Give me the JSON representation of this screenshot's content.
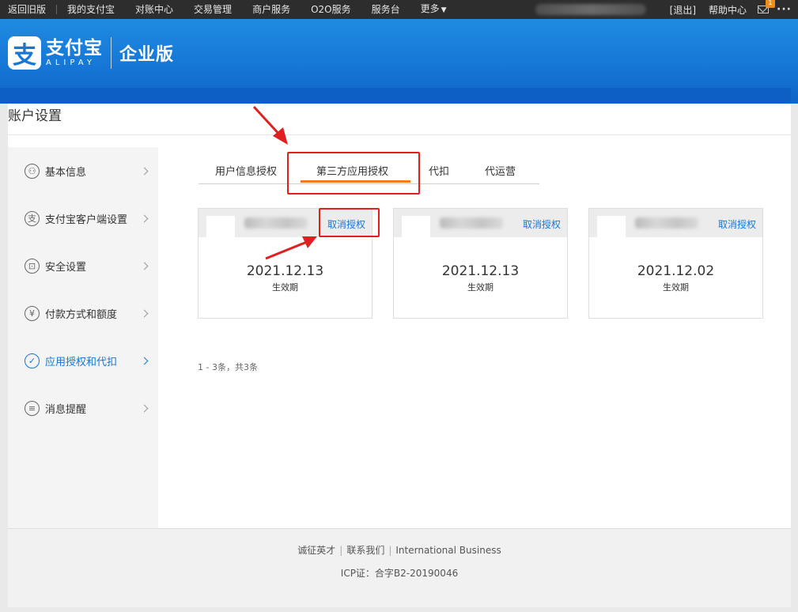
{
  "topnav": {
    "links": [
      "返回旧版",
      "我的支付宝",
      "对账中心",
      "交易管理",
      "商户服务",
      "O2O服务",
      "服务台",
      "更多"
    ],
    "logout": "[退出]",
    "help": "帮助中心",
    "mail_count": "1",
    "more_dots": "···"
  },
  "header": {
    "logo_glyph": "支",
    "brand_cn": "支付宝",
    "brand_en": "ALIPAY",
    "edition": "企业版"
  },
  "page": {
    "title": "账户设置"
  },
  "sidebar": {
    "items": [
      {
        "label": "基本信息",
        "icon": "user-icon",
        "glyph": "⚇"
      },
      {
        "label": "支付宝客户端设置",
        "icon": "alipay-icon",
        "glyph": "支"
      },
      {
        "label": "安全设置",
        "icon": "lock-icon",
        "glyph": "⊡"
      },
      {
        "label": "付款方式和额度",
        "icon": "yen-icon",
        "glyph": "¥"
      },
      {
        "label": "应用授权和代扣",
        "icon": "check-icon",
        "glyph": "✓"
      },
      {
        "label": "消息提醒",
        "icon": "message-icon",
        "glyph": "≡"
      }
    ]
  },
  "tabs": [
    {
      "label": "用户信息授权"
    },
    {
      "label": "第三方应用授权",
      "active": true
    },
    {
      "label": "代扣"
    },
    {
      "label": "代运营"
    }
  ],
  "cards": [
    {
      "revoke": "取消授权",
      "date": "2021.12.13",
      "date_label": "生效期"
    },
    {
      "revoke": "取消授权",
      "date": "2021.12.13",
      "date_label": "生效期"
    },
    {
      "revoke": "取消授权",
      "date": "2021.12.02",
      "date_label": "生效期"
    }
  ],
  "pagination": "1 - 3条，共3条",
  "footer": {
    "links": [
      "诚征英才",
      "联系我们",
      "International Business"
    ],
    "icp": "ICP证：合字B2-20190046"
  },
  "colors": {
    "brand_blue": "#1677d7",
    "tab_orange": "#f37b1d",
    "annotation_red": "#e02020"
  }
}
